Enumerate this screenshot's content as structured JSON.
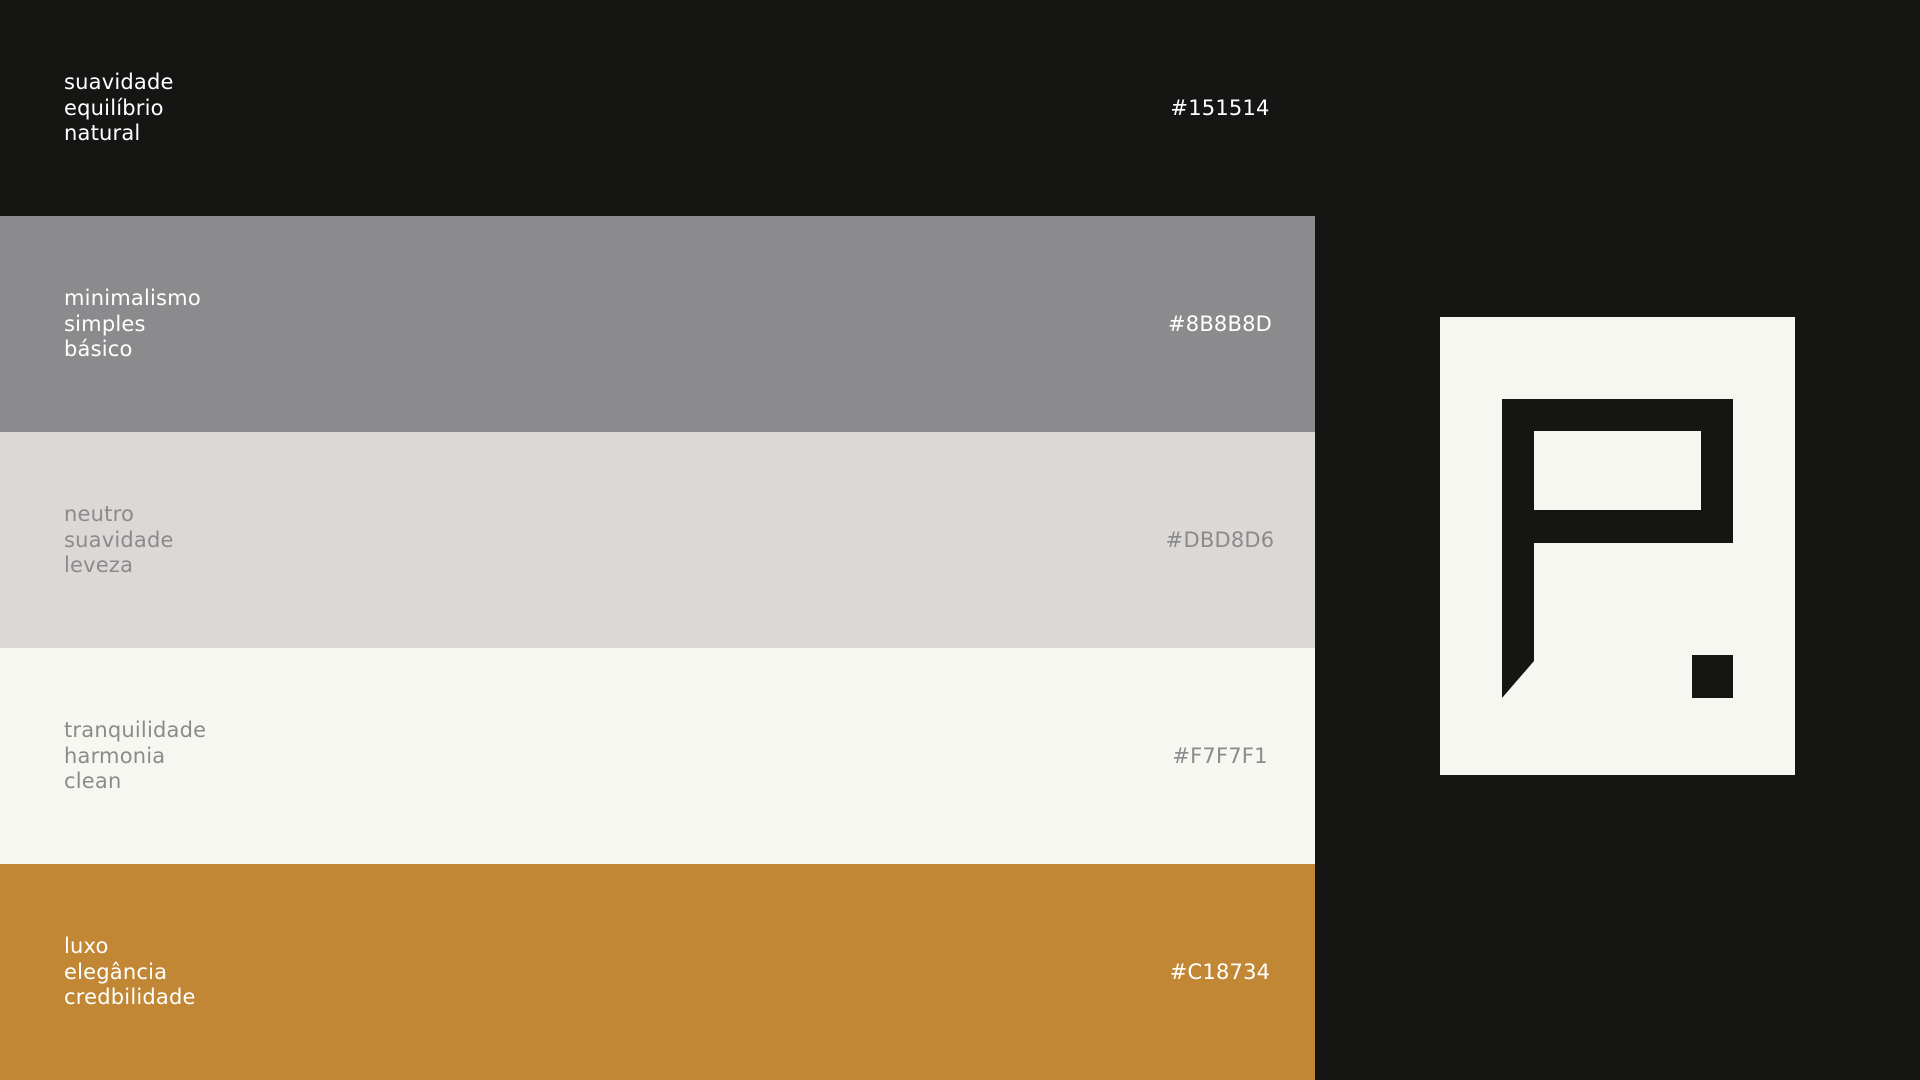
{
  "swatches": [
    {
      "words": [
        "suavidade",
        "equilíbrio",
        "natural"
      ],
      "hex": "#151514",
      "color": "#151514",
      "text_color": "#FFFFFF"
    },
    {
      "words": [
        "minimalismo",
        "simples",
        "básico"
      ],
      "hex": "#8B8B8D",
      "color": "#8B8B8D",
      "text_color": "#FFFFFF"
    },
    {
      "words": [
        "neutro",
        "suavidade",
        "leveza"
      ],
      "hex": "#DBD8D6",
      "color": "#DBD8D6",
      "text_color": "#8B8B8D"
    },
    {
      "words": [
        "tranquilidade",
        "harmonia",
        "clean"
      ],
      "hex": "#F7F7F1",
      "color": "#F7F7F1",
      "text_color": "#8B8B8D"
    },
    {
      "words": [
        "luxo",
        "elegância",
        "credbilidade"
      ],
      "hex": "#C18734",
      "color": "#C18734",
      "text_color": "#FFFFFF"
    }
  ],
  "logo": {
    "icon": "letter-p-logo-icon",
    "background_color": "#F7F7F1",
    "mark_color": "#151514"
  }
}
